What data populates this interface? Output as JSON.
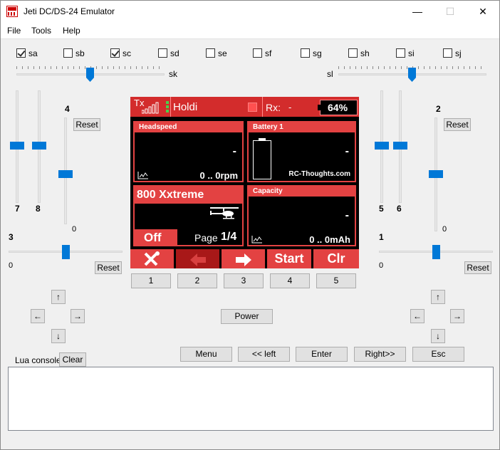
{
  "window": {
    "title": "Jeti DC/DS-24 Emulator",
    "minimize": "—",
    "maximize": "☐",
    "close": "✕"
  },
  "menu": {
    "file": "File",
    "tools": "Tools",
    "help": "Help"
  },
  "switches": [
    {
      "label": "sa",
      "checked": true
    },
    {
      "label": "sb",
      "checked": false
    },
    {
      "label": "sc",
      "checked": true
    },
    {
      "label": "sd",
      "checked": false
    },
    {
      "label": "se",
      "checked": false
    },
    {
      "label": "sf",
      "checked": false
    },
    {
      "label": "sg",
      "checked": false
    },
    {
      "label": "sh",
      "checked": false
    },
    {
      "label": "si",
      "checked": false
    },
    {
      "label": "sj",
      "checked": false
    }
  ],
  "sliders": {
    "sk": "sk",
    "sl": "sl"
  },
  "left_controls": {
    "axis_7": "7",
    "axis_8": "8",
    "axis_4": "4",
    "axis_4_zero": "0",
    "axis_3": "3",
    "axis_3_zero": "0",
    "reset_top": "Reset",
    "reset_bottom": "Reset"
  },
  "right_controls": {
    "axis_5": "5",
    "axis_6": "6",
    "axis_2": "2",
    "axis_2_zero": "0",
    "axis_1": "1",
    "axis_1_zero": "0",
    "reset_top": "Reset",
    "reset_bottom": "Reset"
  },
  "dpad": {
    "up": "↑",
    "left": "←",
    "right": "→",
    "down": "↓"
  },
  "screen": {
    "tx": "Tx",
    "model": "Holdi",
    "rx_label": "Rx:",
    "rx_value": "-",
    "battery_pct": "64%",
    "headspeed_title": "Headspeed",
    "headspeed_dash": "-",
    "headspeed_range": "0 .. 0rpm",
    "battery_title": "Battery 1",
    "battery_dash": "-",
    "battery_credit": "RC-Thoughts.com",
    "model_name": "800 Xxtreme",
    "off_label": "Off",
    "page_label": "Page",
    "page_value": "1/4",
    "capacity_title": "Capacity",
    "capacity_dash": "-",
    "capacity_range": "0 .. 0mAh",
    "soft_start": "Start",
    "soft_clr": "Clr"
  },
  "fkeys": [
    "1",
    "2",
    "3",
    "4",
    "5"
  ],
  "power": "Power",
  "nav": {
    "menu": "Menu",
    "left": "<< left",
    "enter": "Enter",
    "right": "Right>>",
    "esc": "Esc"
  },
  "console": {
    "label": "Lua console",
    "clear": "Clear"
  }
}
